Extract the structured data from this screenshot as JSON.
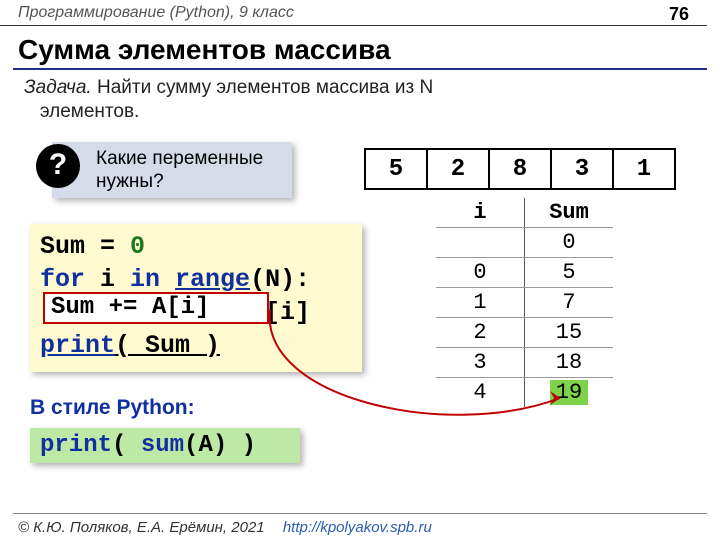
{
  "header": {
    "course": "Программирование (Python), 9 класс",
    "page": "76"
  },
  "title": "Сумма элементов массива",
  "task": {
    "label": "Задача.",
    "text": "Найти сумму элементов массива из N",
    "text2": "элементов."
  },
  "question": {
    "mark": "?",
    "line1": "Какие переменные",
    "line2": "нужны?"
  },
  "array_values": [
    "5",
    "2",
    "8",
    "3",
    "1"
  ],
  "trace": {
    "head_i": "i",
    "head_sum": "Sum",
    "rows": [
      {
        "i": "",
        "sum": "0"
      },
      {
        "i": "0",
        "sum": "5"
      },
      {
        "i": "1",
        "sum": "7"
      },
      {
        "i": "2",
        "sum": "15"
      },
      {
        "i": "3",
        "sum": "18"
      },
      {
        "i": "4",
        "sum": "19"
      }
    ]
  },
  "code": {
    "l1a": "Sum = ",
    "l1b": "0",
    "l2a": "for ",
    "l2b": "i ",
    "l2c": "in ",
    "l2d": "range",
    "l2e": "(N):",
    "hl": "Sum += A[i]",
    "l3b_pre": "  Sum ",
    "l3b_op": "= Sum + A[i]",
    "l4a": "print",
    "l4b": "( Sum )"
  },
  "pystyle": {
    "label": "В стиле Python:",
    "p1": "print",
    "p2": "( ",
    "p3": "sum",
    "p4": "(A) )"
  },
  "footer": {
    "authors": "© К.Ю. Поляков, Е.А. Ерёмин, 2021",
    "url": "http://kpolyakov.spb.ru"
  }
}
